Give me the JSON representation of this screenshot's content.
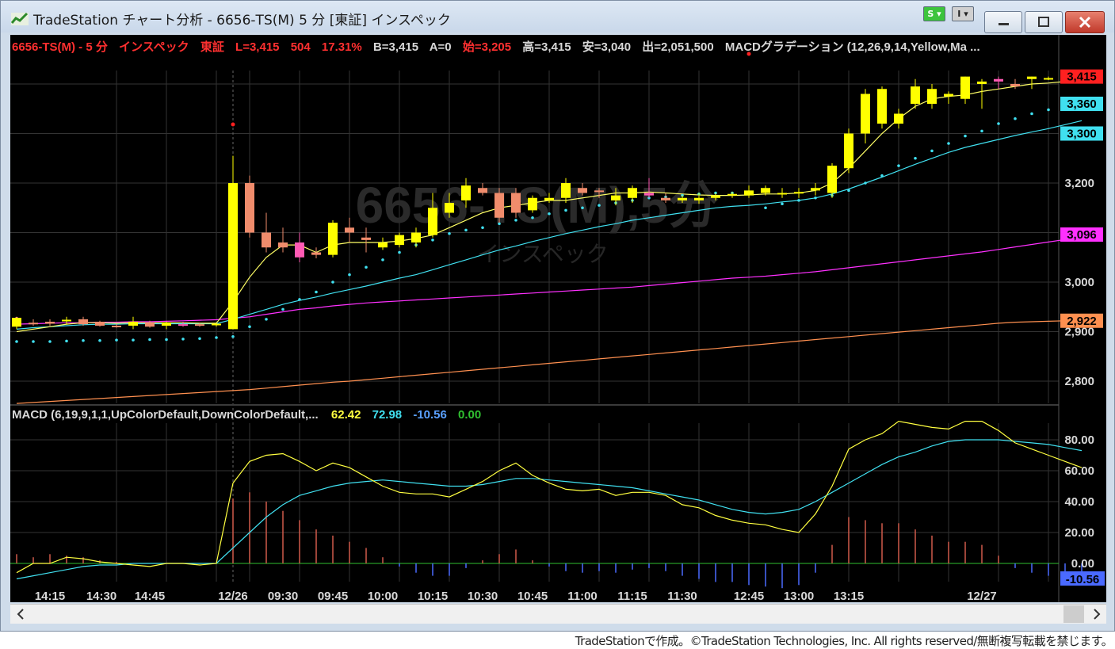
{
  "window": {
    "title": "TradeStation チャート分析 - 6656-TS(M) 5 分 [東証] インスペック",
    "s_button": "S",
    "i_button": "I"
  },
  "status": {
    "symbol": "6656-TS(M) - 5 分",
    "name": "インスペック",
    "exchange": "東証",
    "last": "L=3,415",
    "change": "504",
    "pct": "17.31%",
    "bid": "B=3,415",
    "ask": "A=0",
    "open": "始=3,205",
    "high": "高=3,415",
    "low": "安=3,040",
    "volume": "出=2,051,500",
    "indicator": "MACDグラデーション (12,26,9,14,Yellow,Ma ..."
  },
  "watermark": {
    "symbol": "6656-TS(M),5分",
    "name": "インスペック"
  },
  "macd_header": {
    "label": "MACD (6,19,9,1,1,UpColorDefault,DownColorDefault,...",
    "macd": "62.42",
    "signal": "72.98",
    "hist": "-10.56",
    "zero": "0.00"
  },
  "colors": {
    "up": "#ffff00",
    "down": "#f08c6c",
    "down2": "#ff5ab4",
    "ma_fast": "#ffff66",
    "ma_mid": "#40e0f0",
    "ma_slow": "#ff30ff",
    "ma_long": "#ff9050",
    "psar": "#40e0f0",
    "grid": "#333333"
  },
  "chart_data": {
    "type": "candlestick",
    "price_ticks": [
      2800,
      2900,
      3000,
      3200,
      3300,
      3360
    ],
    "price_tick_labels": [
      "2,800",
      "2,900",
      "3,000",
      "3,200"
    ],
    "price_badges": [
      {
        "label": "3,415",
        "value": 3415,
        "color": "#ff2020"
      },
      {
        "label": "3,360",
        "value": 3360,
        "color": "#40e0f0"
      },
      {
        "label": "3,300",
        "value": 3300,
        "color": "#40e0f0"
      },
      {
        "label": "3,096",
        "value": 3096,
        "color": "#ff30ff"
      },
      {
        "label": "2,922",
        "value": 2922,
        "color": "#ff9050"
      }
    ],
    "macd_ticks": [
      0,
      20,
      40,
      60,
      80
    ],
    "macd_tick_labels": [
      "0.00",
      "20.00",
      "40.00",
      "60.00",
      "80.00"
    ],
    "macd_badge": "-10.56",
    "x_labels": [
      "14:15",
      "14:30",
      "14:45",
      "12/26",
      "09:30",
      "09:45",
      "10:00",
      "10:15",
      "10:30",
      "10:45",
      "11:00",
      "11:15",
      "11:30",
      "12:45",
      "13:00",
      "13:15",
      "12/27"
    ],
    "candles": [
      [
        2910,
        2930,
        2905,
        2928
      ],
      [
        2918,
        2925,
        2912,
        2915
      ],
      [
        2920,
        2925,
        2912,
        2916
      ],
      [
        2922,
        2930,
        2914,
        2924
      ],
      [
        2925,
        2930,
        2912,
        2915
      ],
      [
        2920,
        2922,
        2910,
        2912
      ],
      [
        2912,
        2916,
        2908,
        2910
      ],
      [
        2912,
        2930,
        2905,
        2920
      ],
      [
        2918,
        2922,
        2908,
        2910
      ],
      [
        2912,
        2920,
        2905,
        2918
      ],
      [
        2915,
        2920,
        2910,
        2912
      ],
      [
        2915,
        2918,
        2910,
        2914
      ],
      [
        2914,
        2918,
        2910,
        2916
      ],
      [
        2905,
        3255,
        2905,
        3200
      ],
      [
        3200,
        3215,
        3090,
        3100
      ],
      [
        3100,
        3140,
        3060,
        3070
      ],
      [
        3080,
        3110,
        3060,
        3070
      ],
      [
        3080,
        3100,
        3040,
        3050
      ],
      [
        3060,
        3070,
        3048,
        3055
      ],
      [
        3055,
        3125,
        3050,
        3120
      ],
      [
        3110,
        3130,
        3080,
        3100
      ],
      [
        3090,
        3110,
        3060,
        3085
      ],
      [
        3070,
        3090,
        3065,
        3080
      ],
      [
        3075,
        3100,
        3070,
        3095
      ],
      [
        3080,
        3110,
        3070,
        3100
      ],
      [
        3095,
        3180,
        3090,
        3150
      ],
      [
        3140,
        3180,
        3130,
        3160
      ],
      [
        3165,
        3210,
        3150,
        3195
      ],
      [
        3190,
        3200,
        3175,
        3180
      ],
      [
        3180,
        3190,
        3120,
        3130
      ],
      [
        3180,
        3190,
        3130,
        3140
      ],
      [
        3145,
        3175,
        3140,
        3170
      ],
      [
        3165,
        3180,
        3160,
        3170
      ],
      [
        3170,
        3210,
        3160,
        3200
      ],
      [
        3190,
        3200,
        3175,
        3180
      ],
      [
        3185,
        3190,
        3170,
        3182
      ],
      [
        3165,
        3190,
        3155,
        3175
      ],
      [
        3170,
        3195,
        3160,
        3190
      ],
      [
        3180,
        3210,
        3170,
        3175
      ],
      [
        3170,
        3180,
        3160,
        3165
      ],
      [
        3165,
        3175,
        3160,
        3170
      ],
      [
        3165,
        3180,
        3158,
        3170
      ],
      [
        3170,
        3180,
        3165,
        3175
      ],
      [
        3175,
        3182,
        3170,
        3178
      ],
      [
        3175,
        3195,
        3170,
        3185
      ],
      [
        3180,
        3195,
        3175,
        3190
      ],
      [
        3180,
        3190,
        3170,
        3180
      ],
      [
        3180,
        3190,
        3170,
        3182
      ],
      [
        3185,
        3200,
        3175,
        3190
      ],
      [
        3180,
        3240,
        3170,
        3235
      ],
      [
        3230,
        3310,
        3220,
        3300
      ],
      [
        3300,
        3390,
        3280,
        3380
      ],
      [
        3320,
        3395,
        3310,
        3390
      ],
      [
        3320,
        3350,
        3310,
        3340
      ],
      [
        3360,
        3410,
        3350,
        3395
      ],
      [
        3360,
        3400,
        3350,
        3390
      ],
      [
        3375,
        3385,
        3360,
        3380
      ],
      [
        3370,
        3415,
        3360,
        3415
      ],
      [
        3400,
        3410,
        3350,
        3405
      ],
      [
        3410,
        3415,
        3390,
        3405
      ],
      [
        3400,
        3410,
        3390,
        3395
      ],
      [
        3410,
        3415,
        3390,
        3415
      ],
      [
        3410,
        3415,
        3408,
        3412
      ],
      [
        3412,
        3415,
        3410,
        3414
      ],
      [
        3413,
        3415,
        3412,
        3415
      ]
    ],
    "psar": [
      2880,
      2880,
      2880,
      2881,
      2882,
      2882,
      2883,
      2883,
      2884,
      2884,
      2885,
      2886,
      2888,
      2890,
      2910,
      2925,
      2945,
      2965,
      2980,
      3000,
      3015,
      3030,
      3045,
      3060,
      3075,
      3085,
      3098,
      3105,
      3110,
      3118,
      3125,
      3130,
      3138,
      3145,
      3150,
      3155,
      3160,
      3165,
      3170,
      3172,
      3175,
      3178,
      3180,
      3180,
      3180,
      3150,
      3158,
      3165,
      3170,
      3175,
      3185,
      3200,
      3215,
      3235,
      3250,
      3265,
      3280,
      3295,
      3305,
      3320,
      3330,
      3340,
      3348,
      3355,
      3360
    ],
    "ma_fast": [
      2900,
      2905,
      2910,
      2915,
      2918,
      2918,
      2917,
      2918,
      2918,
      2918,
      2918,
      2917,
      2917,
      2960,
      3010,
      3050,
      3075,
      3075,
      3060,
      3075,
      3080,
      3080,
      3080,
      3083,
      3088,
      3095,
      3110,
      3125,
      3140,
      3150,
      3155,
      3160,
      3165,
      3165,
      3170,
      3175,
      3180,
      3180,
      3182,
      3180,
      3178,
      3176,
      3175,
      3175,
      3176,
      3178,
      3178,
      3180,
      3185,
      3200,
      3230,
      3265,
      3300,
      3330,
      3355,
      3370,
      3375,
      3378,
      3385,
      3390,
      3395,
      3400,
      3402,
      3405,
      3410
    ],
    "ma_mid": [
      2905,
      2908,
      2910,
      2912,
      2914,
      2915,
      2915,
      2916,
      2916,
      2916,
      2916,
      2916,
      2916,
      2925,
      2935,
      2945,
      2955,
      2963,
      2970,
      2978,
      2985,
      2992,
      3000,
      3008,
      3015,
      3025,
      3035,
      3045,
      3055,
      3065,
      3073,
      3082,
      3090,
      3098,
      3105,
      3112,
      3118,
      3125,
      3130,
      3135,
      3140,
      3145,
      3150,
      3153,
      3155,
      3158,
      3162,
      3165,
      3170,
      3178,
      3188,
      3200,
      3212,
      3225,
      3238,
      3250,
      3262,
      3272,
      3280,
      3288,
      3296,
      3303,
      3310,
      3318,
      3326
    ],
    "ma_slow": [
      2915,
      2916,
      2917,
      2918,
      2918,
      2919,
      2919,
      2920,
      2920,
      2921,
      2922,
      2923,
      2924,
      2927,
      2930,
      2935,
      2940,
      2945,
      2948,
      2952,
      2955,
      2958,
      2960,
      2962,
      2964,
      2966,
      2968,
      2970,
      2972,
      2974,
      2976,
      2978,
      2980,
      2982,
      2984,
      2986,
      2988,
      2990,
      2993,
      2996,
      2999,
      3002,
      3005,
      3008,
      3010,
      3012,
      3015,
      3018,
      3021,
      3025,
      3029,
      3033,
      3037,
      3041,
      3045,
      3049,
      3053,
      3057,
      3061,
      3066,
      3071,
      3076,
      3081,
      3086,
      3096
    ],
    "ma_long": [
      2755,
      2757,
      2759,
      2761,
      2763,
      2765,
      2767,
      2769,
      2771,
      2773,
      2775,
      2777,
      2779,
      2781,
      2783,
      2786,
      2789,
      2792,
      2795,
      2798,
      2800,
      2803,
      2806,
      2809,
      2812,
      2815,
      2818,
      2821,
      2824,
      2827,
      2830,
      2833,
      2836,
      2839,
      2842,
      2845,
      2848,
      2851,
      2854,
      2857,
      2860,
      2863,
      2866,
      2869,
      2872,
      2875,
      2878,
      2881,
      2884,
      2887,
      2890,
      2893,
      2896,
      2899,
      2902,
      2905,
      2908,
      2911,
      2914,
      2917,
      2919,
      2920,
      2921,
      2922,
      2922
    ],
    "macd_line": [
      -6,
      0,
      0,
      4,
      3,
      1,
      0,
      -1,
      -2,
      0,
      0,
      -1,
      0,
      52,
      66,
      70,
      71,
      66,
      60,
      65,
      62,
      56,
      50,
      46,
      45,
      45,
      43,
      48,
      53,
      60,
      65,
      57,
      52,
      48,
      47,
      48,
      44,
      46,
      46,
      44,
      38,
      36,
      31,
      28,
      26,
      25,
      22,
      20,
      32,
      50,
      74,
      80,
      84,
      92,
      90,
      88,
      87,
      92,
      92,
      86,
      78,
      74,
      70,
      66,
      62
    ],
    "signal_line": [
      -10,
      -8,
      -6,
      -4,
      -2,
      -1,
      -1,
      0,
      0,
      0,
      0,
      0,
      0,
      10,
      20,
      30,
      38,
      44,
      47,
      50,
      52,
      53,
      54,
      53,
      52,
      51,
      50,
      50,
      51,
      53,
      55,
      55,
      54,
      53,
      52,
      51,
      50,
      49,
      47,
      45,
      43,
      41,
      38,
      35,
      33,
      32,
      33,
      35,
      40,
      46,
      52,
      58,
      64,
      69,
      72,
      76,
      79,
      80,
      80,
      80,
      79,
      78,
      77,
      75,
      73
    ],
    "hist": [
      6,
      4,
      6,
      5,
      4,
      2,
      1,
      0,
      0,
      0,
      0,
      0,
      0,
      42,
      46,
      40,
      34,
      28,
      22,
      18,
      14,
      10,
      4,
      -2,
      -6,
      -8,
      -8,
      -3,
      2,
      6,
      9,
      2,
      -2,
      -5,
      -6,
      -5,
      -6,
      -4,
      -3,
      -5,
      -8,
      -10,
      -12,
      -12,
      -14,
      -15,
      -16,
      -14,
      -6,
      12,
      30,
      28,
      26,
      26,
      22,
      18,
      14,
      14,
      12,
      5,
      -3,
      -6,
      -8,
      -10,
      -11
    ]
  },
  "footer": "TradeStationで作成。©TradeStation Technologies, Inc. All rights reserved/無断複写転載を禁じます。"
}
